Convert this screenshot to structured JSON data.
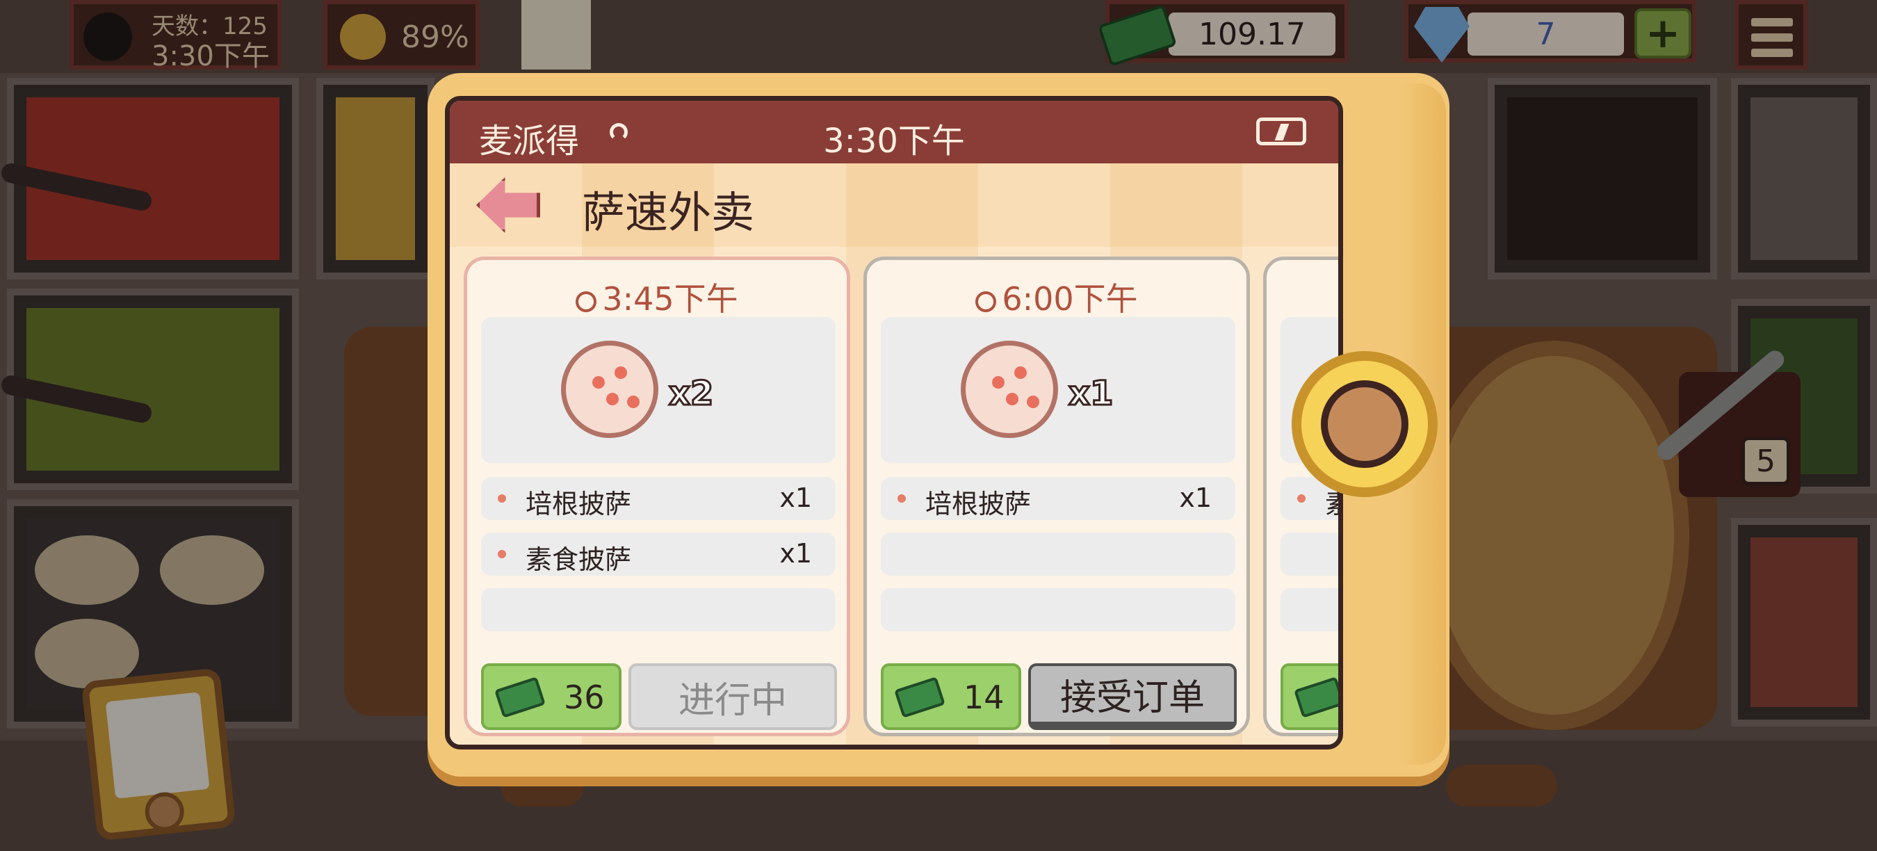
{
  "hud": {
    "day_label": "天数：125",
    "clock": "3:30下午",
    "happiness": "89%",
    "money": "109.17",
    "gems": "7",
    "plus": "+",
    "tongs_count": "5"
  },
  "phone": {
    "app_name": "麦派得",
    "time": "3:30下午",
    "page_title": "萨速外卖"
  },
  "orders": [
    {
      "time": "3:45下午",
      "quantity": "x2",
      "items": [
        {
          "name": "培根披萨",
          "qty": "x1"
        },
        {
          "name": "素食披萨",
          "qty": "x1"
        }
      ],
      "price": "36",
      "action": "进行中"
    },
    {
      "time": "6:00下午",
      "quantity": "x1",
      "items": [
        {
          "name": "培根披萨",
          "qty": "x1"
        }
      ],
      "price": "14",
      "action": "接受订单"
    },
    {
      "items": [
        {
          "name": "素"
        }
      ]
    }
  ],
  "colors": {
    "status_bar": "#8a3d36",
    "tablet": "#f2c878",
    "price_green": "#9bd06b",
    "accent_red": "#b0523e"
  }
}
